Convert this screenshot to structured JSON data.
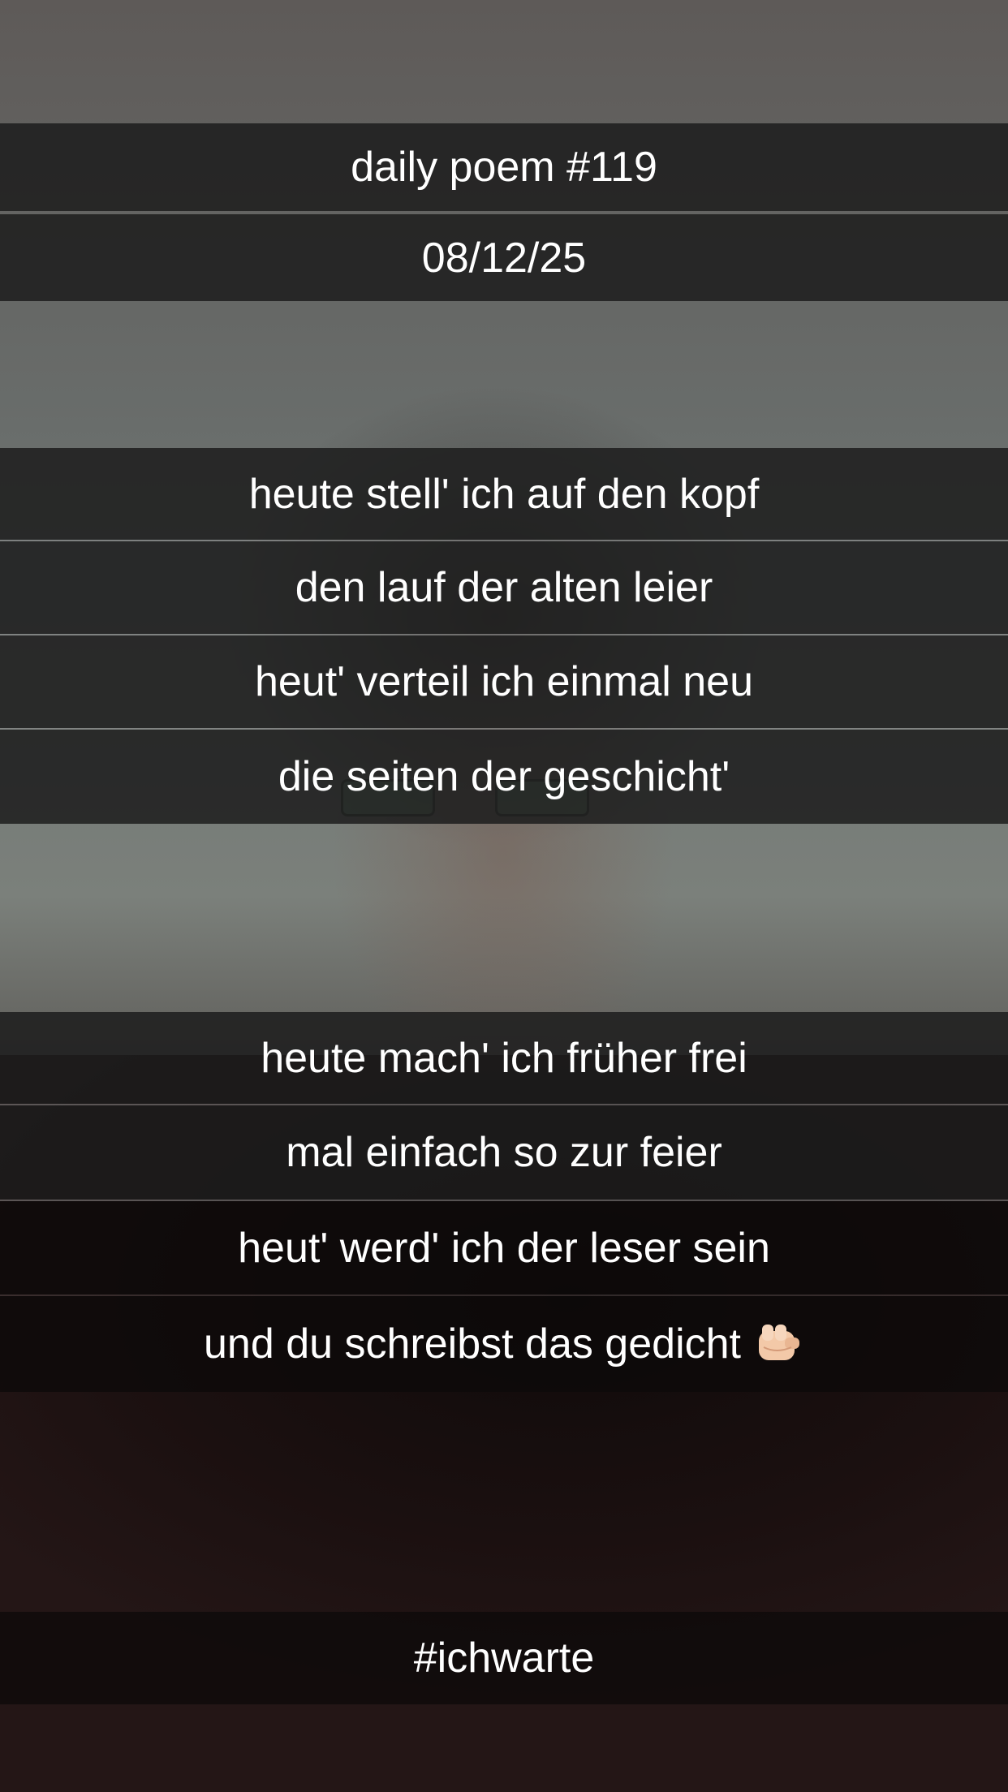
{
  "header": {
    "title": "daily poem #119",
    "date": "08/12/25"
  },
  "stanza1": {
    "lines": [
      "heute stell' ich auf den kopf",
      "den lauf der alten leier",
      "heut' verteil ich einmal neu",
      "die seiten der geschicht'"
    ]
  },
  "stanza2": {
    "lines": [
      "heute mach' ich früher frei",
      "mal einfach so zur feier",
      "heut' werd' ich der leser sein",
      "und du schreibst das gedicht"
    ],
    "end_icon": "pointing-at-viewer-icon"
  },
  "footer": {
    "hashtag": "#ichwarte"
  }
}
